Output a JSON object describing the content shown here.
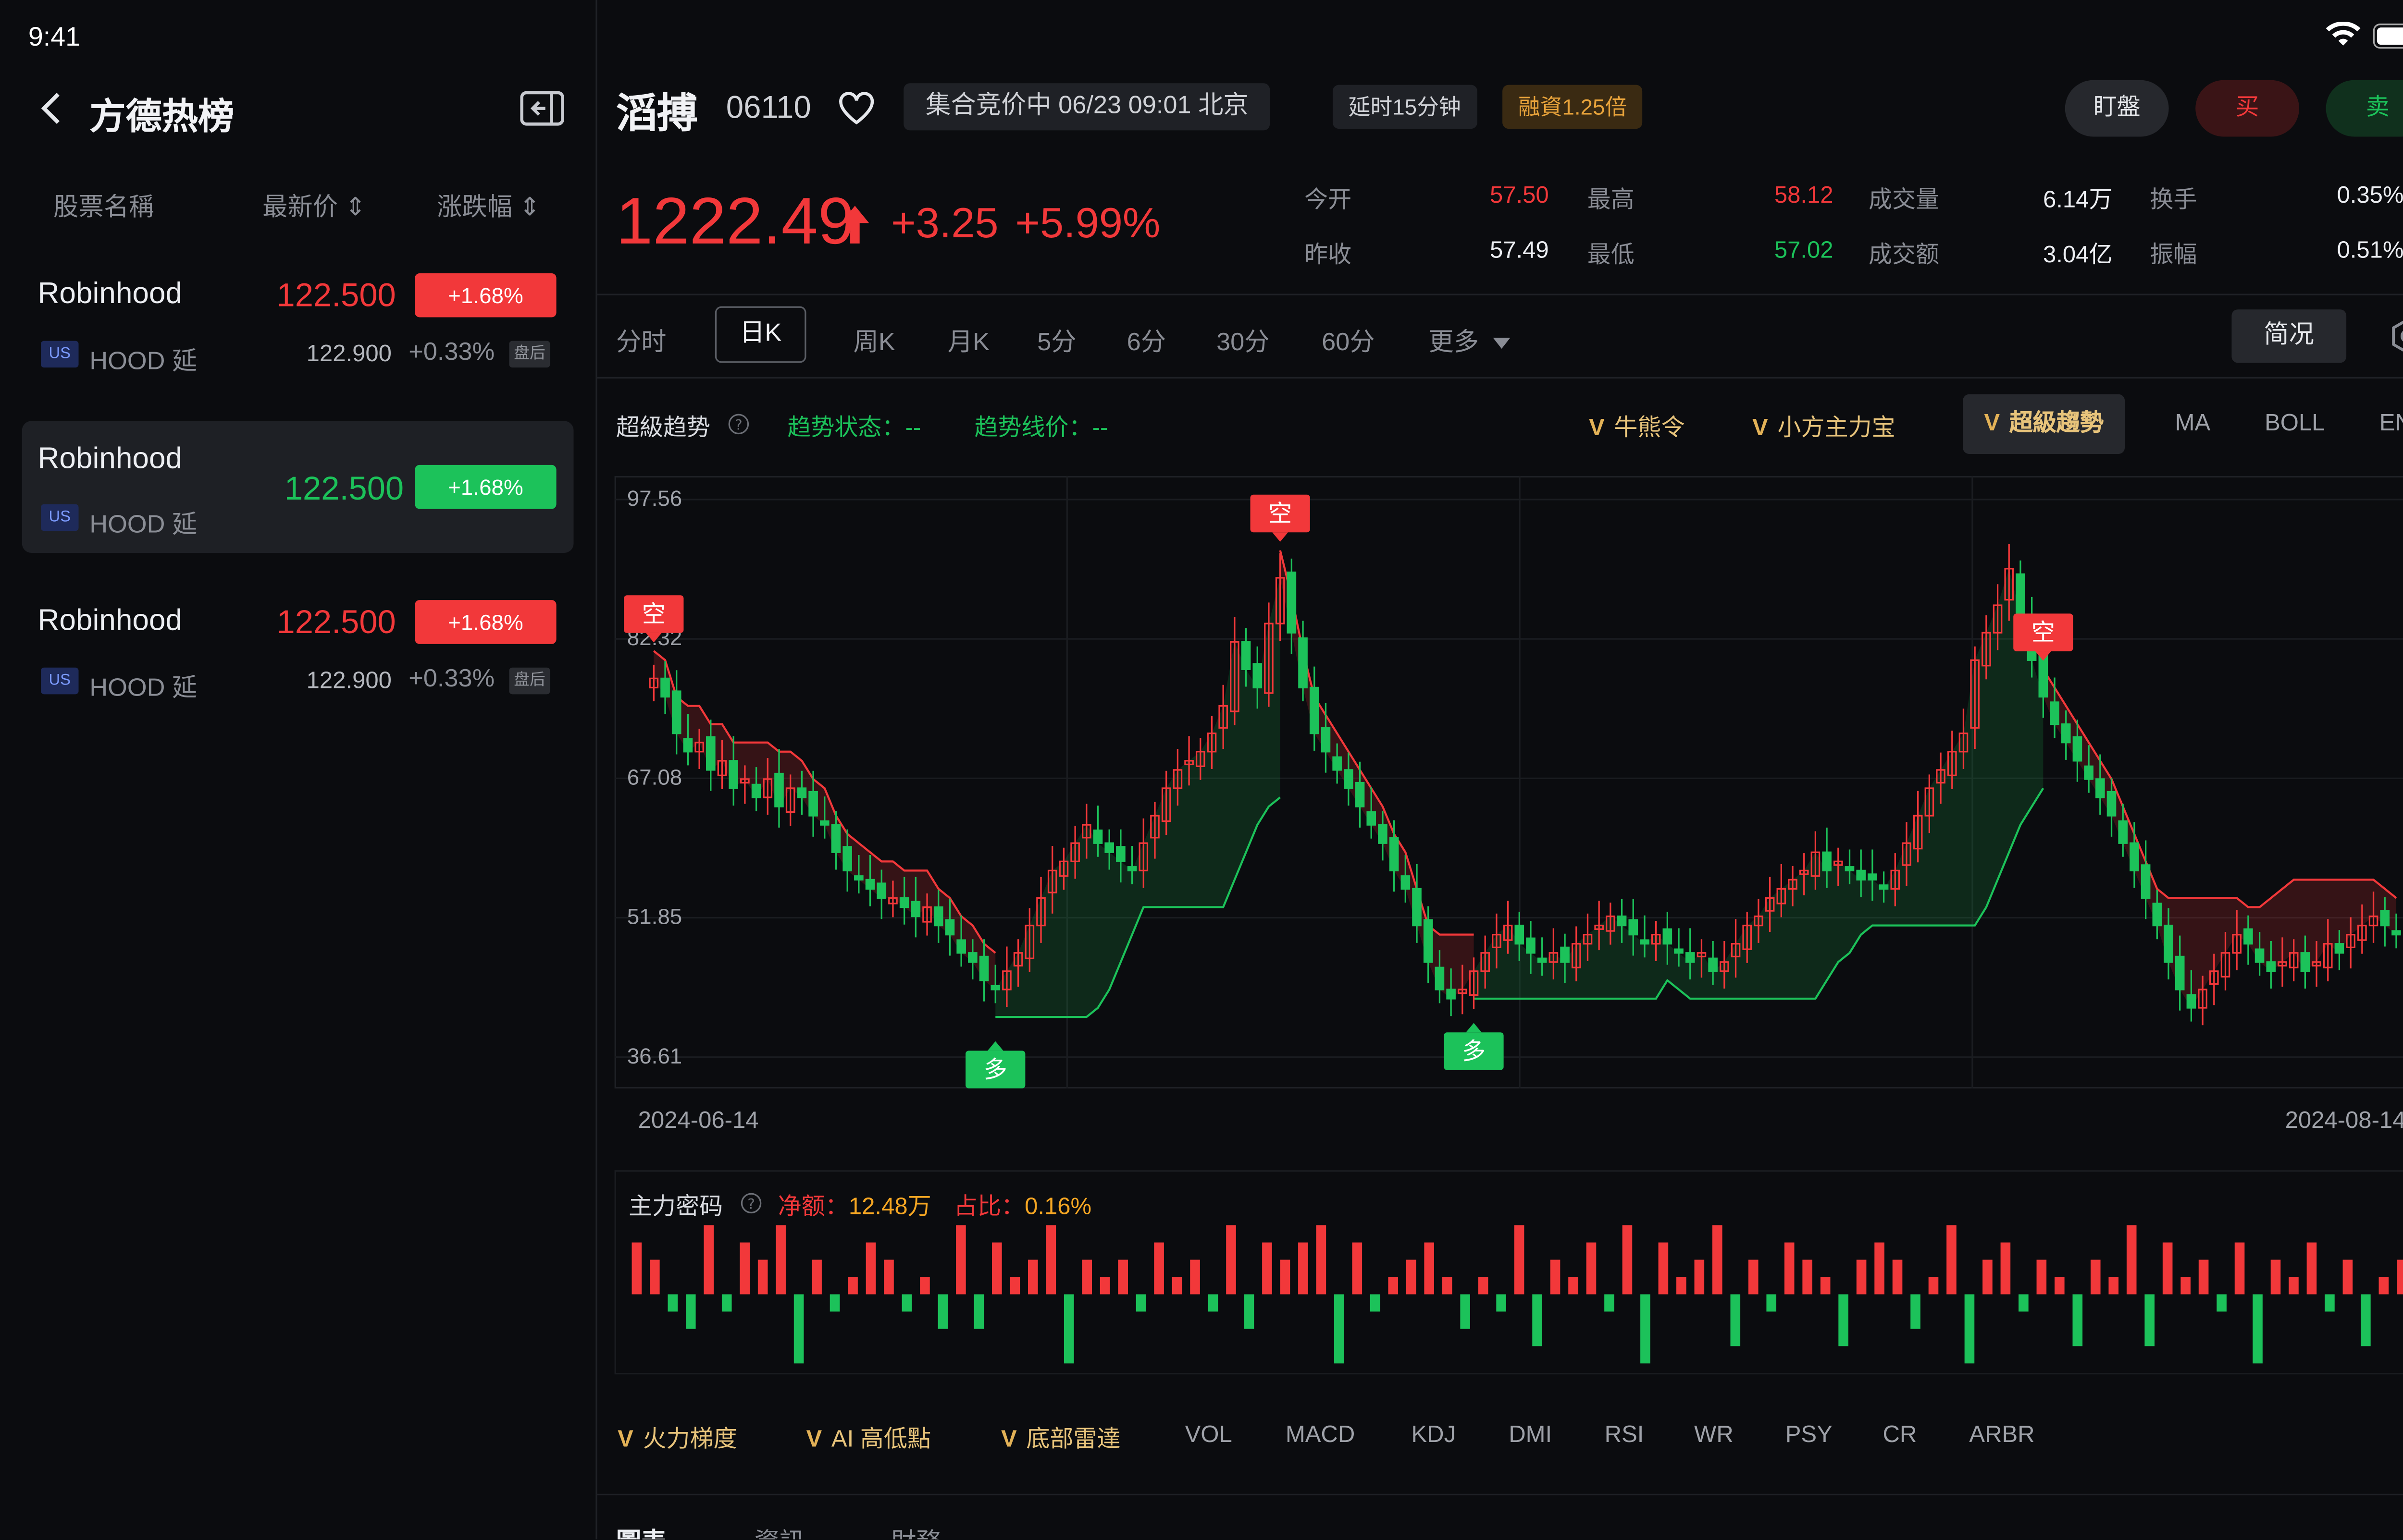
{
  "status_bar": {
    "time": "9:41"
  },
  "sidebar": {
    "title": "方德热榜",
    "columns": [
      "股票名稱",
      "最新价 ⇕",
      "涨跌幅 ⇕"
    ],
    "items": [
      {
        "name": "Robinhood",
        "market": "US",
        "code": "HOOD 延",
        "price": "122.500",
        "change": "+1.68%",
        "post_price": "122.900",
        "post_change": "+0.33%",
        "post_label": "盘后",
        "price_color": "red",
        "change_color": "red"
      },
      {
        "name": "Robinhood",
        "market": "US",
        "code": "HOOD 延",
        "price": "122.500",
        "change": "+1.68%",
        "price_color": "green",
        "change_color": "green",
        "selected": true
      },
      {
        "name": "Robinhood",
        "market": "US",
        "code": "HOOD 延",
        "price": "122.500",
        "change": "+1.68%",
        "post_price": "122.900",
        "post_change": "+0.33%",
        "post_label": "盘后",
        "price_color": "red",
        "change_color": "red"
      }
    ]
  },
  "header": {
    "name": "滔搏",
    "code": "06110",
    "auction": "集合竞价中 06/23 09:01 北京",
    "delay": "延时15分钟",
    "margin": "融資1.25倍",
    "watch_label": "盯盤",
    "buy_label": "买",
    "sell_label": "卖"
  },
  "quote": {
    "price": "1222.49",
    "change": "+3.25",
    "change_pct": "+5.99%",
    "stats": [
      {
        "label": "今开",
        "value": "57.50",
        "color": "red"
      },
      {
        "label": "最高",
        "value": "58.12",
        "color": "red"
      },
      {
        "label": "成交量",
        "value": "6.14万",
        "color": "white"
      },
      {
        "label": "换手",
        "value": "0.35%",
        "color": "white"
      },
      {
        "label": "昨收",
        "value": "57.49",
        "color": "white"
      },
      {
        "label": "最低",
        "value": "57.02",
        "color": "green"
      },
      {
        "label": "成交额",
        "value": "3.04亿",
        "color": "white"
      },
      {
        "label": "振幅",
        "value": "0.51%",
        "color": "white"
      }
    ]
  },
  "period_tabs": [
    "分时",
    "日K",
    "周K",
    "月K",
    "5分",
    "6分",
    "30分",
    "60分",
    "更多"
  ],
  "period_active": "日K",
  "intro_button": "简况",
  "indicator_bar": {
    "title": "超級趋势",
    "status_label": "趋势状态：--",
    "line_label": "趋势线价：--",
    "tabs": [
      "牛熊令",
      "小方主力宝",
      "超級趨勢",
      "MA",
      "BOLL",
      "ENE"
    ],
    "active": "超級趨勢"
  },
  "chart_data": {
    "type": "candlestick",
    "y_ticks": [
      "97.56",
      "82.32",
      "67.08",
      "51.85",
      "36.61"
    ],
    "ylim": [
      36.61,
      97.56
    ],
    "x_start": "2024-06-14",
    "x_end": "2024-08-14",
    "signals": [
      {
        "label": "空",
        "type": "sell",
        "index": 0
      },
      {
        "label": "多",
        "type": "buy",
        "index": 30
      },
      {
        "label": "空",
        "type": "sell",
        "index": 55
      },
      {
        "label": "多",
        "type": "buy",
        "index": 72
      },
      {
        "label": "空",
        "type": "sell",
        "index": 122
      }
    ],
    "closes": [
      78,
      76,
      72,
      70,
      71,
      68,
      69,
      66,
      67,
      65,
      67,
      64,
      66,
      65,
      63,
      62,
      59,
      57,
      56,
      55,
      54,
      54,
      53,
      52,
      53,
      51,
      50,
      48,
      47,
      45,
      44,
      46,
      48,
      51,
      54,
      57,
      58,
      60,
      62,
      60,
      59,
      58,
      57,
      60,
      63,
      66,
      68,
      69,
      70,
      72,
      75,
      82,
      79,
      77,
      84,
      89,
      83,
      77,
      72,
      70,
      68,
      66,
      64,
      62,
      60,
      57,
      55,
      51,
      47,
      44,
      43,
      44,
      46,
      48,
      50,
      51,
      49,
      48,
      47,
      48,
      47,
      49,
      50,
      51,
      52,
      51,
      50,
      49,
      50,
      49,
      48,
      47,
      48,
      46,
      47,
      49,
      51,
      52,
      54,
      55,
      56,
      57,
      59,
      57,
      58,
      57,
      56,
      56,
      55,
      57,
      60,
      63,
      66,
      68,
      70,
      72,
      80,
      83,
      86,
      90,
      85,
      80,
      76,
      73,
      71,
      69,
      67,
      65,
      63,
      60,
      57,
      54,
      51,
      47,
      44,
      42,
      44,
      46,
      48,
      50,
      49,
      47,
      46,
      47,
      48,
      46,
      47,
      49,
      48,
      50,
      51,
      52,
      51,
      50
    ]
  },
  "main_force": {
    "title": "主力密码",
    "net_label": "净额：",
    "net_value": "12.48万",
    "ratio_label": "占比：",
    "ratio_value": "0.16%",
    "bars": [
      3,
      2,
      -1,
      -2,
      4,
      -1,
      3,
      2,
      4,
      -4,
      2,
      -1,
      1,
      3,
      2,
      -1,
      1,
      -2,
      4,
      -2,
      3,
      1,
      2,
      4,
      -4,
      2,
      1,
      2,
      -1,
      3,
      1,
      2,
      -1,
      4,
      -2,
      3,
      2,
      3,
      4,
      -4,
      3,
      -1,
      1,
      2,
      3,
      1,
      -2,
      1,
      -1,
      4,
      -3,
      2,
      1,
      3,
      -1,
      4,
      -4,
      3,
      1,
      2,
      4,
      -3,
      2,
      -1,
      3,
      2,
      1,
      -3,
      2,
      3,
      2,
      -2,
      1,
      4,
      -4,
      2,
      3,
      -1,
      2,
      1,
      -3,
      2,
      1,
      4,
      -3,
      3,
      1,
      2,
      -1,
      3,
      -4,
      2,
      1,
      3,
      -1,
      2,
      -3,
      1,
      2,
      3
    ]
  },
  "bottom_tabs": [
    "火力梯度",
    "AI 高低點",
    "底部雷達",
    "VOL",
    "MACD",
    "KDJ",
    "DMI",
    "RSI",
    "WR",
    "PSY",
    "CR",
    "ARBR"
  ],
  "bottom_v_tabs": [
    "火力梯度",
    "AI 高低點",
    "底部雷達"
  ],
  "footer_tabs": [
    "圖表",
    "資訊",
    "財務"
  ],
  "colors": {
    "up": "#f2383a",
    "down": "#1cc25a",
    "gold": "#e8c47b",
    "bg": "#0b0c0f"
  }
}
